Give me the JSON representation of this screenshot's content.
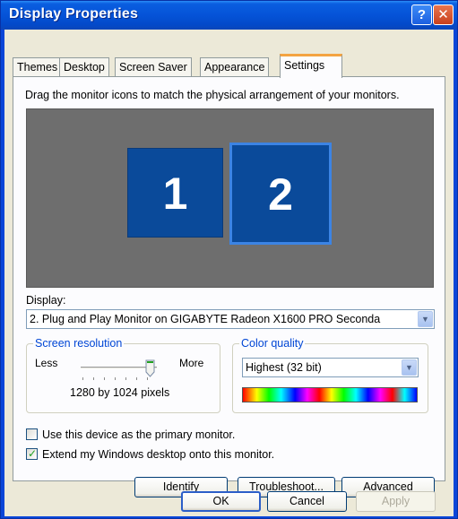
{
  "window": {
    "title": "Display Properties",
    "help_button": "?",
    "close_button": "✕"
  },
  "tabs": [
    {
      "label": "Themes",
      "active": false
    },
    {
      "label": "Desktop",
      "active": false
    },
    {
      "label": "Screen Saver",
      "active": false
    },
    {
      "label": "Appearance",
      "active": false
    },
    {
      "label": "Settings",
      "active": true
    }
  ],
  "settings": {
    "instruction": "Drag the monitor icons to match the physical arrangement of your monitors.",
    "monitors": [
      {
        "number": "1",
        "selected": false
      },
      {
        "number": "2",
        "selected": true
      }
    ],
    "display_label": "Display:",
    "display_value": "2. Plug and Play Monitor on GIGABYTE Radeon X1600 PRO Seconda",
    "screen_resolution": {
      "legend": "Screen resolution",
      "less_label": "Less",
      "more_label": "More",
      "slider_position_fraction": 1.0,
      "value_text": "1280 by 1024 pixels"
    },
    "color_quality": {
      "legend": "Color quality",
      "selected": "Highest (32 bit)"
    },
    "checkboxes": [
      {
        "label": "Use this device as the primary monitor.",
        "checked": false
      },
      {
        "label": "Extend my Windows desktop onto this monitor.",
        "checked": true
      }
    ],
    "buttons": {
      "identify": "Identify",
      "troubleshoot": "Troubleshoot...",
      "advanced": "Advanced"
    }
  },
  "dialog_buttons": {
    "ok": "OK",
    "cancel": "Cancel",
    "apply": "Apply",
    "apply_enabled": false
  },
  "colors": {
    "titlebar": "#0553d8",
    "dialog_bg": "#ece9d8",
    "monitor_area": "#6e6e6e",
    "monitor_fill": "#0a4a9a",
    "group_legend": "#0046d5",
    "active_tab_accent": "#f4a442"
  }
}
